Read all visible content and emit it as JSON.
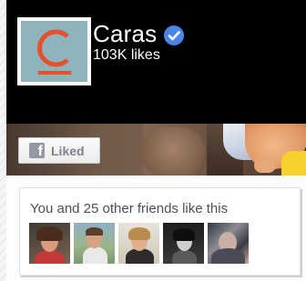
{
  "page": {
    "name": "Caras",
    "verified": true,
    "likes": "103K likes",
    "logo_letter": "C"
  },
  "like_button": {
    "label": "Liked",
    "icon": "facebook-f-icon",
    "state": "liked"
  },
  "social": {
    "text": "You and 25 other friends like this",
    "friends": [
      {
        "avatar": "friend-avatar-1"
      },
      {
        "avatar": "friend-avatar-2"
      },
      {
        "avatar": "friend-avatar-3"
      },
      {
        "avatar": "friend-avatar-4"
      },
      {
        "avatar": "friend-avatar-5"
      }
    ]
  },
  "colors": {
    "logo_bg": "#8fb3ba",
    "logo_mark": "#e3502a",
    "verified_badge": "#4a86e8",
    "cover_bg": "#000000"
  }
}
